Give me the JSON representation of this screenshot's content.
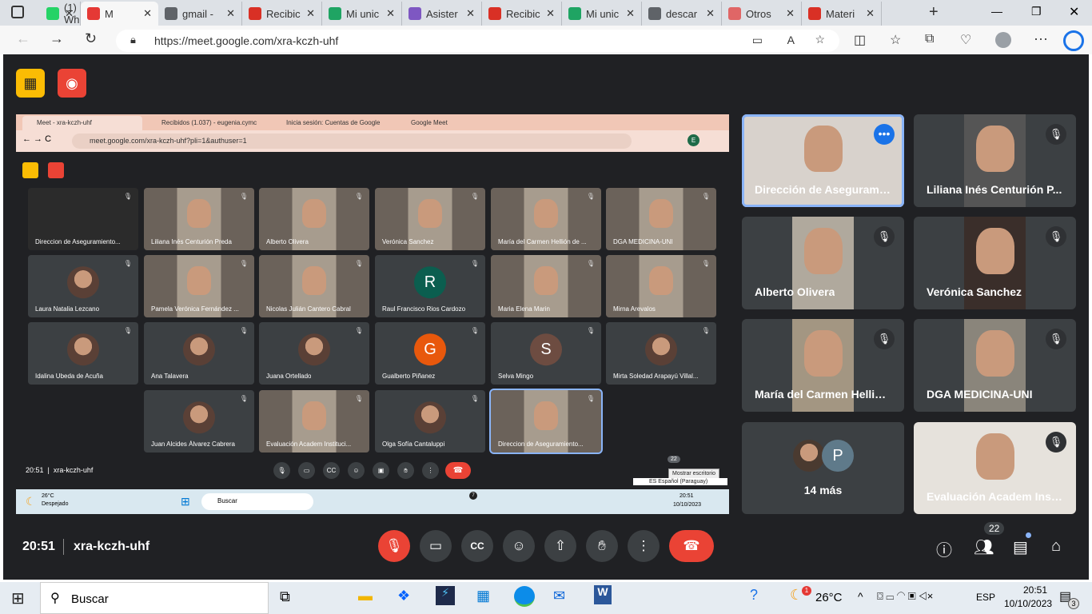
{
  "browser": {
    "tabs": [
      {
        "label": "(1) Wh",
        "icon": "whatsapp-icon",
        "color": "#25d366"
      },
      {
        "label": "M",
        "icon": "meet-icon",
        "color": "#e53935",
        "active": true
      },
      {
        "label": "gmail -",
        "icon": "search-icon",
        "color": "#5f6368"
      },
      {
        "label": "Recibic",
        "icon": "gmail-icon",
        "color": "#d93025"
      },
      {
        "label": "Mi unic",
        "icon": "drive-icon",
        "color": "#1fa463"
      },
      {
        "label": "Asister",
        "icon": "forms-icon",
        "color": "#7e57c2"
      },
      {
        "label": "Recibic",
        "icon": "gmail-icon",
        "color": "#d93025"
      },
      {
        "label": "Mi unic",
        "icon": "drive-icon",
        "color": "#1fa463"
      },
      {
        "label": "descar",
        "icon": "search-icon",
        "color": "#5f6368"
      },
      {
        "label": "Otros",
        "icon": "help-icon",
        "color": "#e06666"
      },
      {
        "label": "Materi",
        "icon": "pdf-icon",
        "color": "#d93025"
      }
    ],
    "url": "https://meet.google.com/xra-kczh-uhf"
  },
  "nested": {
    "tabs": [
      "Meet - xra-kczh-uhf",
      "Recibidos (1.037) - eugenia.cymc",
      "Inicia sesión: Cuentas de Google",
      "Google Meet"
    ],
    "url": "meet.google.com/xra-kczh-uhf?pli=1&authuser=1",
    "profile": "E",
    "time": "20:51",
    "code": "xra-kczh-uhf",
    "people_count": "22",
    "tooltip": "Mostrar escritorio",
    "lang": "ES Español (Paraguay)",
    "tiles": [
      {
        "name": "Direccion de Aseguramiento...",
        "type": "screen"
      },
      {
        "name": "Liliana Inés Centurión Preda",
        "type": "video"
      },
      {
        "name": "Alberto Olivera",
        "type": "video"
      },
      {
        "name": "Verónica Sanchez",
        "type": "video"
      },
      {
        "name": "María del Carmen Hellión de ...",
        "type": "video"
      },
      {
        "name": "DGA MEDICINA-UNI",
        "type": "video"
      },
      {
        "name": "Laura Natalia Lezcano",
        "type": "photo"
      },
      {
        "name": "Pamela Verónica Fernández ...",
        "type": "video"
      },
      {
        "name": "Nicolas Julián Cantero Cabral",
        "type": "video"
      },
      {
        "name": "Raul Francisco Rios Cardozo",
        "type": "letter",
        "letter": "R",
        "color": "#0b5e4f"
      },
      {
        "name": "Maria Elena Marin",
        "type": "video"
      },
      {
        "name": "Mirna Arevalos",
        "type": "video"
      },
      {
        "name": "Idalina Ubeda de Acuña",
        "type": "photo"
      },
      {
        "name": "Ana Talavera",
        "type": "photo"
      },
      {
        "name": "Juana Ortellado",
        "type": "photo"
      },
      {
        "name": "Gualberto Piñanez",
        "type": "letter",
        "letter": "G",
        "color": "#e8580c"
      },
      {
        "name": "Selva Mingo",
        "type": "letter",
        "letter": "S",
        "color": "#6d4c41"
      },
      {
        "name": "Mirta Soledad Arapayú Villal...",
        "type": "photo"
      },
      {
        "name": "Juan Alcides Álvarez Cabrera",
        "type": "photo"
      },
      {
        "name": "Evaluación Academ Instituci...",
        "type": "video"
      },
      {
        "name": "Olga Sofía Cantaluppi",
        "type": "photo"
      },
      {
        "name": "Direccion de Aseguramiento...",
        "type": "video",
        "active": true
      }
    ],
    "taskbar": {
      "weather_temp": "26°C",
      "weather_desc": "Despejado",
      "search": "Buscar",
      "whatsapp_badge": "7",
      "time": "20:51",
      "date": "10/10/2023"
    }
  },
  "tiles": [
    {
      "name": "Dirección de Asegurami...",
      "active": true,
      "bg": "#d8d2cc"
    },
    {
      "name": "Liliana Inés Centurión P...",
      "bg": "#555"
    },
    {
      "name": "Alberto Olivera",
      "bg": "#b0a99d"
    },
    {
      "name": "Verónica Sanchez",
      "bg": "#3a2e2a"
    },
    {
      "name": "María del Carmen Hellió...",
      "bg": "#a39682"
    },
    {
      "name": "DGA MEDICINA-UNI",
      "bg": "#8a857b"
    },
    {
      "name": "14 más",
      "type": "more",
      "letter": "P"
    },
    {
      "name": "Evaluación Academ Inst...",
      "bg": "#e6e2dc"
    }
  ],
  "footer": {
    "time": "20:51",
    "code": "xra-kczh-uhf",
    "people_count": "22"
  },
  "taskbar": {
    "search": "Buscar",
    "temp": "26°C",
    "weather_badge": "1",
    "lang": "ESP",
    "time": "20:51",
    "date": "10/10/2023",
    "notif": "3"
  }
}
